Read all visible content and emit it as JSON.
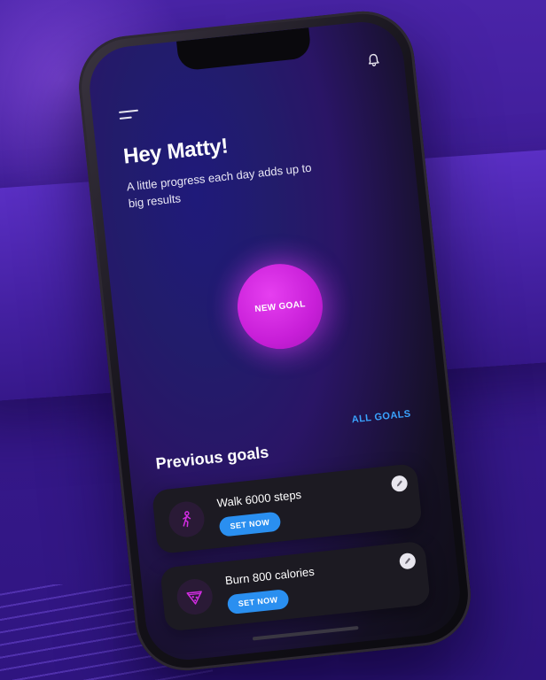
{
  "header": {
    "greeting": "Hey Matty!",
    "subtitle": "A little progress each day adds up to big results"
  },
  "main": {
    "new_goal_label": "NEW GOAL",
    "previous_title": "Previous goals",
    "all_goals_label": "ALL GOALS"
  },
  "goals": [
    {
      "title": "Walk 6000 steps",
      "button": "SET NOW",
      "icon": "walking-person-icon"
    },
    {
      "title": "Burn 800 calories",
      "button": "SET NOW",
      "icon": "pizza-slice-icon"
    }
  ],
  "icons": {
    "notification": "bell-icon",
    "menu": "hamburger-menu-icon",
    "edit": "pencil-icon"
  },
  "colors": {
    "accent_magenta": "#d22de2",
    "accent_blue": "#2a8ff0",
    "link_blue": "#3aa3ff",
    "card_bg": "#1c1a22",
    "background_purple": "#3b1b92"
  }
}
